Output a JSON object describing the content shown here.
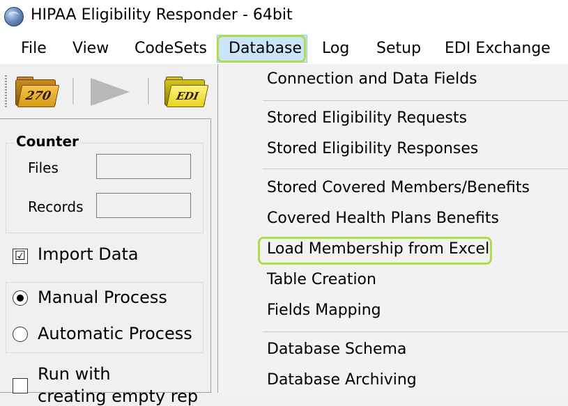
{
  "window": {
    "title": "HIPAA Eligibility Responder - 64bit"
  },
  "menu": {
    "file": "File",
    "view": "View",
    "codesets": "CodeSets",
    "database": "Database",
    "log": "Log",
    "setup": "Setup",
    "edi_exchange": "EDI Exchange"
  },
  "toolbar": {
    "open270_label": "270",
    "edi_label": "EDI"
  },
  "counter": {
    "title": "Counter",
    "files_label": "Files",
    "files_value": "",
    "records_label": "Records",
    "records_value": ""
  },
  "options": {
    "import_data": "Import Data",
    "import_checked": "☑",
    "manual_process": "Manual Process",
    "automatic_process": "Automatic Process",
    "run_with": "Run with",
    "run_with_cont": "creating empty rep"
  },
  "database_menu": {
    "connection": "Connection and Data Fields",
    "stored_requests": "Stored Eligibility Requests",
    "stored_responses": "Stored Eligibility Responses",
    "stored_members": "Stored Covered Members/Benefits",
    "covered_plans": "Covered Health Plans Benefits",
    "load_membership": "Load Membership from Excel",
    "table_creation": "Table Creation",
    "fields_mapping": "Fields Mapping",
    "schema": "Database Schema",
    "archiving": "Database Archiving"
  },
  "colors": {
    "highlight": "#a9e04a",
    "menu_active": "#cce4f7"
  }
}
